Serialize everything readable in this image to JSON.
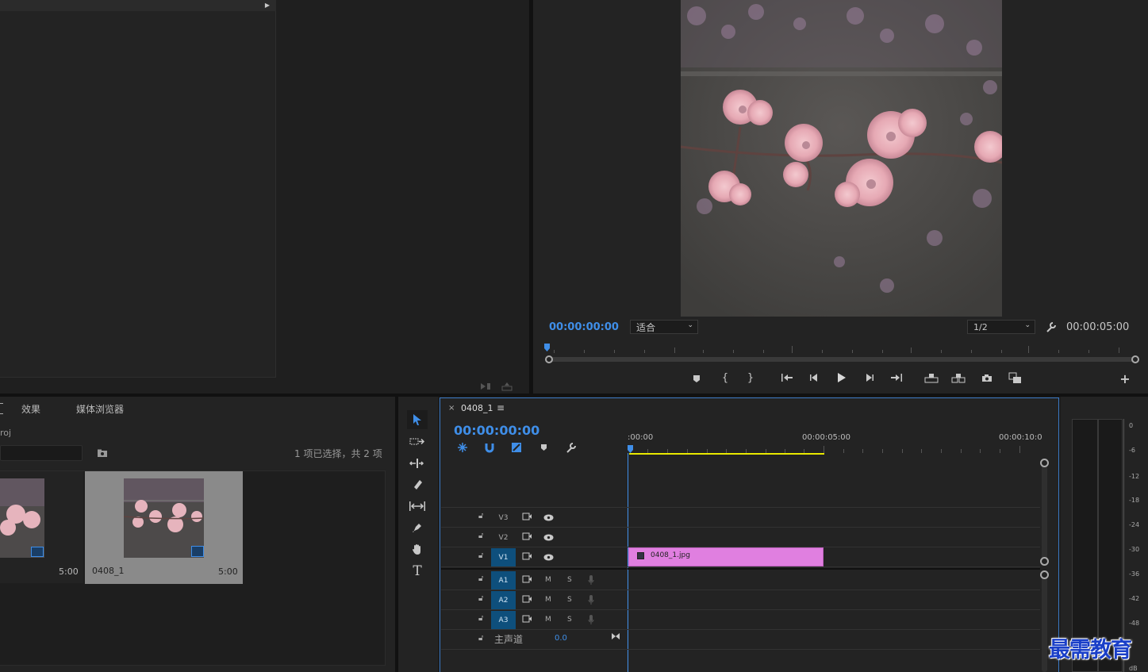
{
  "source_monitor": {
    "overlay_icons": [
      "insert-icon",
      "export-icon"
    ]
  },
  "program_monitor": {
    "timecode": "00:00:00:00",
    "fit_select": "适合",
    "resolution_select": "1/2",
    "duration": "00:00:05:00"
  },
  "project_panel": {
    "tabs": [
      "效果",
      "媒体浏览器"
    ],
    "project_name": "roj",
    "selection_status": "1 项已选择，共 2 项",
    "items": [
      {
        "name": "",
        "duration": "5:00"
      },
      {
        "name": "0408_1",
        "duration": "5:00"
      }
    ]
  },
  "timeline": {
    "sequence_name": "0408_1",
    "close_glyph": "×",
    "menu_glyph": "≡",
    "timecode": "00:00:00:00",
    "ruler": [
      ":00:00",
      "00:00:05:00",
      "00:00:10:0"
    ],
    "video_tracks": [
      {
        "label": "V3",
        "targeted": false
      },
      {
        "label": "V2",
        "targeted": false
      },
      {
        "label": "V1",
        "targeted": true
      }
    ],
    "audio_tracks": [
      {
        "label": "A1",
        "m": "M",
        "s": "S"
      },
      {
        "label": "A2",
        "m": "M",
        "s": "S"
      },
      {
        "label": "A3",
        "m": "M",
        "s": "S"
      }
    ],
    "master": {
      "label": "主声道",
      "value": "0.0"
    },
    "clip": {
      "name": "0408_1.jpg",
      "color": "#e07fe0"
    }
  },
  "audio_meter": {
    "scale": [
      "0",
      "-6",
      "-12",
      "-18",
      "-24",
      "-30",
      "-36",
      "-42",
      "-48",
      "dB"
    ]
  },
  "watermark": "最需教育",
  "colors": {
    "accent": "#3f8ee8",
    "work_area": "#e8e800",
    "clip": "#e07fe0"
  }
}
